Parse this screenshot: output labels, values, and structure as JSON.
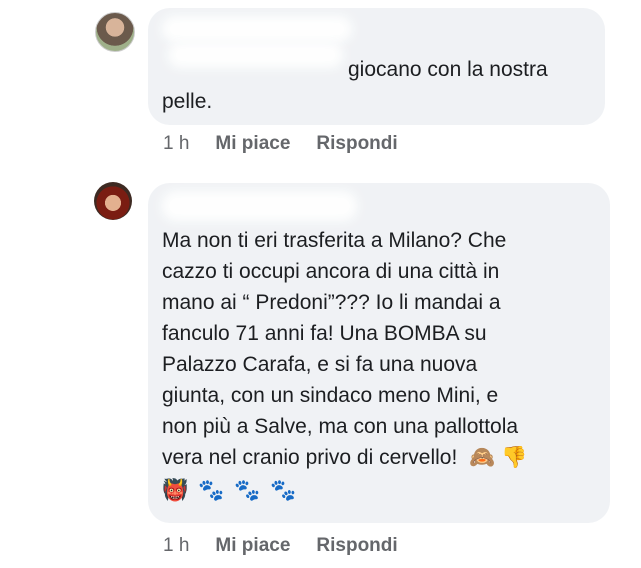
{
  "comments": [
    {
      "text_lines": [
        "giocano con la nostra",
        "pelle."
      ],
      "time": "1 h",
      "like_label": "Mi piace",
      "reply_label": "Rispondi"
    },
    {
      "text_lines": [
        "Ma non ti eri trasferita a Milano? Che",
        "cazzo ti occupi ancora di una città in",
        "mano ai “ Predoni”???  Io li mandai a",
        "fanculo 71 anni fa!  Una BOMBA su",
        "Palazzo Carafa, e si fa una nuova",
        "giunta, con un sindaco meno Mini, e",
        "non più a Salve, ma con una pallottola",
        "vera nel cranio privo di cervello!"
      ],
      "end_emojis": [
        "🙈",
        "👎"
      ],
      "last_line_emojis": [
        "👹",
        "🐾",
        "🐾",
        "🐾"
      ],
      "time": "1 h",
      "like_label": "Mi piace",
      "reply_label": "Rispondi"
    }
  ]
}
